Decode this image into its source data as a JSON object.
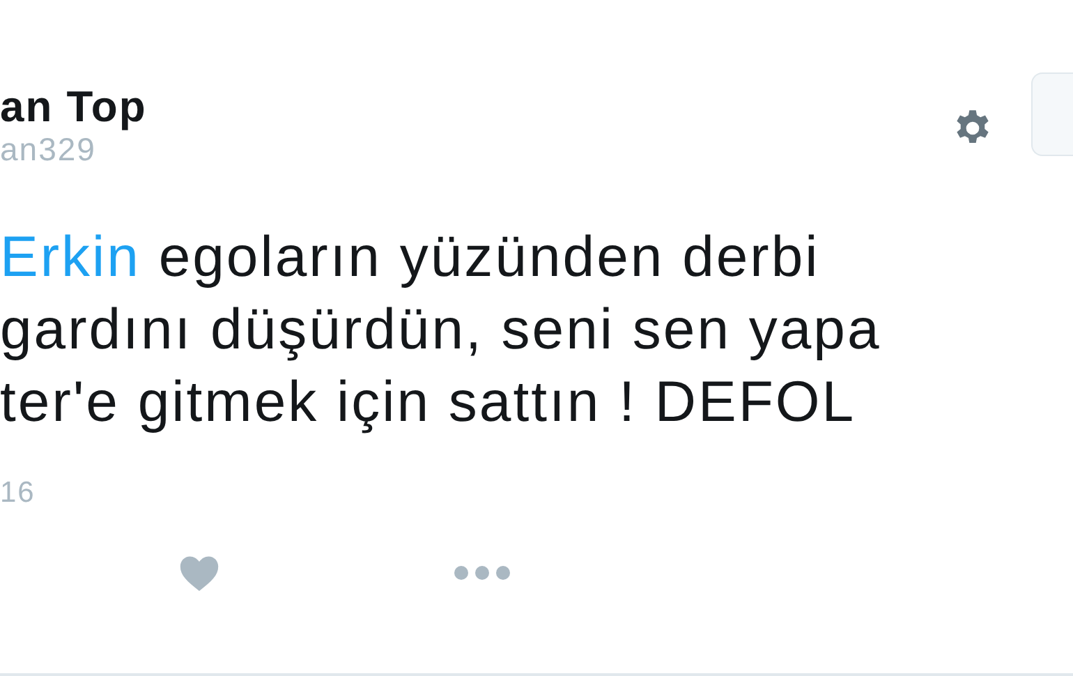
{
  "author": {
    "name": "an Top",
    "handle": "an329"
  },
  "tweet": {
    "mention": "Erkin",
    "lines": [
      " egoların yüzünden derbi",
      "gardını düşürdün, seni sen yapa",
      "ter'e gitmek için sattın ! DEFOL"
    ]
  },
  "date": "16"
}
